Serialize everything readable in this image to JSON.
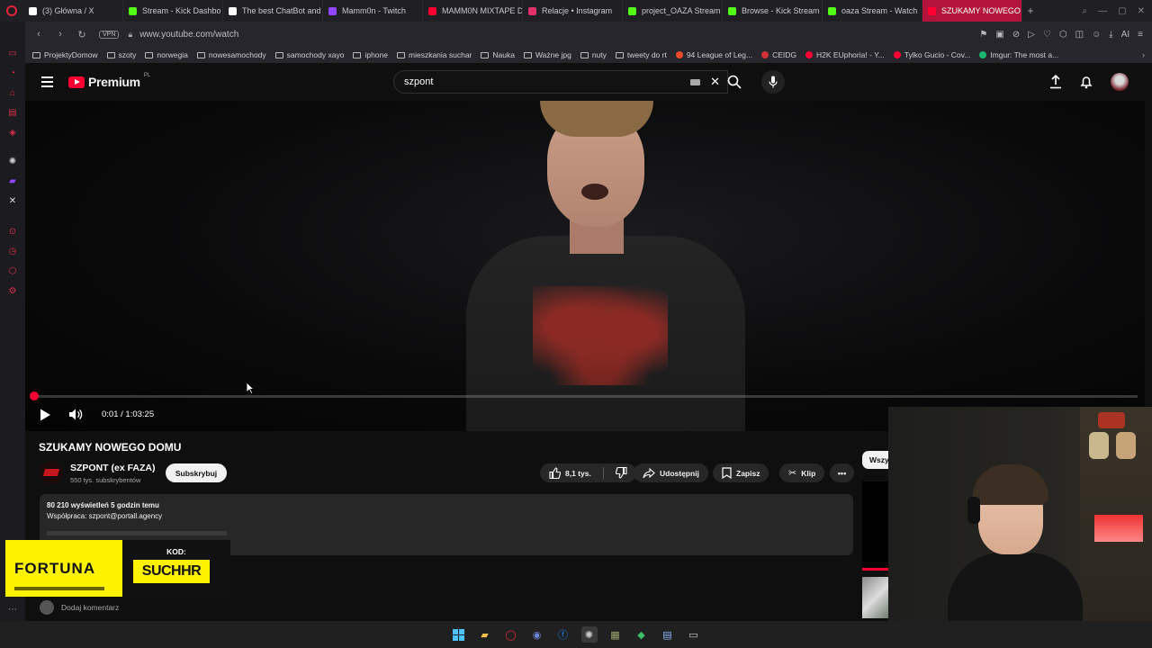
{
  "browser": {
    "tabs": [
      {
        "label": "(3) Główna / X",
        "icon": "x-icon",
        "icon_color": "#ffffff"
      },
      {
        "label": "Stream - Kick Dashbo",
        "icon": "kick-icon",
        "icon_color": "#53fc18"
      },
      {
        "label": "The best ChatBot and",
        "icon": "chatbot-icon",
        "icon_color": "#ffffff"
      },
      {
        "label": "Mamm0n - Twitch",
        "icon": "twitch-icon",
        "icon_color": "#9146ff"
      },
      {
        "label": "MAMM0N MIXTAPE D",
        "icon": "youtube-icon",
        "icon_color": "#ff0033"
      },
      {
        "label": "Relacje • Instagram",
        "icon": "instagram-icon",
        "icon_color": "#e1306c"
      },
      {
        "label": "project_OAZA Stream",
        "icon": "kick-icon",
        "icon_color": "#53fc18"
      },
      {
        "label": "Browse - Kick Stream",
        "icon": "kick-icon",
        "icon_color": "#53fc18"
      },
      {
        "label": "oaza Stream - Watch",
        "icon": "kick-icon",
        "icon_color": "#53fc18"
      },
      {
        "label": "SZUKAMY NOWEGO DOM",
        "icon": "youtube-icon",
        "icon_color": "#ff0033",
        "active": true
      }
    ],
    "new_tab": "+",
    "url": "www.youtube.com/watch",
    "vpn": "VPN",
    "bookmarks": [
      {
        "label": "ProjektyDomow",
        "type": "folder"
      },
      {
        "label": "szoty",
        "type": "folder"
      },
      {
        "label": "norwegia",
        "type": "folder"
      },
      {
        "label": "nowesamochody",
        "type": "folder"
      },
      {
        "label": "samochody xayo",
        "type": "folder"
      },
      {
        "label": "iphone",
        "type": "folder"
      },
      {
        "label": "mieszkania suchar",
        "type": "folder"
      },
      {
        "label": "Nauka",
        "type": "folder"
      },
      {
        "label": "Ważne jpg",
        "type": "folder"
      },
      {
        "label": "nuty",
        "type": "folder"
      },
      {
        "label": "tweety do rt",
        "type": "folder"
      },
      {
        "label": "94 League of Leg...",
        "type": "site",
        "color": "#e84a2c"
      },
      {
        "label": "CEIDG",
        "type": "site",
        "color": "#d0313a"
      },
      {
        "label": "H2K EUphoria! - Y...",
        "type": "site",
        "color": "#ff0033"
      },
      {
        "label": "Tylko Gucio - Cov...",
        "type": "site",
        "color": "#ff0033"
      },
      {
        "label": "Imgur: The most a...",
        "type": "site",
        "color": "#1bb76e"
      }
    ],
    "addr_ai": "AI"
  },
  "youtube": {
    "logo_text": "Premium",
    "logo_region": "PL",
    "search": {
      "value": "szpont"
    },
    "video": {
      "time_current": "0:01",
      "time_total": "1:03:25",
      "time_display": "0:01 / 1:03:25",
      "progress_fraction": 0.0003
    },
    "title": "SZUKAMY NOWEGO DOMU",
    "channel": {
      "name": "SZPONT (ex FAZA)",
      "subs": "550 tys. subskrybentów"
    },
    "subscribe_label": "Subskrybuj",
    "actions": {
      "likes": "8,1 tys.",
      "share": "Udostępnij",
      "save": "Zapisz",
      "clip": "Klip",
      "more": "•••"
    },
    "description": {
      "stats": "80 210 wyświetleń  5 godzin temu",
      "collab": "Współpraca: szpont@portall.agency"
    },
    "comment_placeholder": "Dodaj komentarz",
    "chip_label": "Wszy",
    "accent": "#ff0033"
  },
  "sponsor": {
    "brand": "FORTUNA",
    "code_label": "KOD:",
    "code": "SUCHHR",
    "bg": "#fff200"
  }
}
